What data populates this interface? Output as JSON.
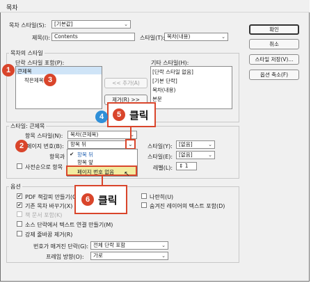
{
  "window": {
    "title": "목차"
  },
  "buttons": {
    "ok": "확인",
    "cancel": "취소",
    "save_style": "스타일 저장(V)...",
    "fewer_options": "옵션 축소(F)",
    "add": "<< 추가(A)",
    "remove": "제거(R) >>"
  },
  "top": {
    "toc_style_label": "목차 스타일(S):",
    "toc_style_value": "[기본값]",
    "title_label": "제목(I):",
    "title_value": "Contents",
    "style_label": "스타일(T):",
    "style_value": "목차(내용)"
  },
  "styles_section": {
    "heading": "목차의 스타일",
    "include_label": "단락 스타일 포함(P):",
    "include_items": [
      "큰제목",
      "작은제목"
    ],
    "other_label": "기타 스타일(H):",
    "other_items": [
      "[단락 스타일 없음]",
      "[기본 단락]",
      "목차(내용)",
      "본문"
    ]
  },
  "style_section": {
    "heading": "스타일: 큰제목",
    "entry_style_label": "항목 스타일(N):",
    "entry_style_value": "목차(큰제목)",
    "page_number_label": "페이지 번호(B):",
    "page_number_value": "항목 뒤",
    "entry_between_label": "항목과",
    "sort_label": "사전순으로 항목",
    "style_y_label": "스타일(Y):",
    "style_y_value": "[없음]",
    "style_e_label": "스타일(E):",
    "style_e_value": "[없음]",
    "level_label": "레벨(L):",
    "level_value": "1"
  },
  "dropdown": {
    "options": [
      "항목 뒤",
      "항목 앞",
      "페이지 번호 없음"
    ],
    "selected_index": 0
  },
  "options_section": {
    "heading": "옵션",
    "pdf_bookmark": "PDF 책갈피 만들기(C)",
    "replace_existing": "기존 목차 바꾸기(X)",
    "include_book": "책 문서 포함(K)",
    "make_text_anchor": "소스 단락에서 텍스트 연결 만들기(M)",
    "remove_forced_breaks": "강제 줄바꿈 제거(R)",
    "run_in": "나란히(U)",
    "hidden_layers": "숨겨진 레이어의 텍스트 포함(D)",
    "numbered_label": "번호가 매겨진 단락(G):",
    "numbered_value": "전체 단락 포함",
    "frame_direction_label": "프레임 방향(O):",
    "frame_direction_value": "가로",
    "checkbox_states": {
      "pdf_bookmark": true,
      "replace_existing": true,
      "include_book": false,
      "make_text_anchor": false,
      "remove_forced_breaks": false,
      "run_in": false,
      "hidden_layers": false
    }
  },
  "annotations": {
    "badges": [
      "1",
      "2",
      "3",
      "4",
      "5",
      "6"
    ],
    "click_text": "클릭",
    "colors": {
      "red": "#d9452b",
      "blue": "#2f8fd8"
    }
  }
}
